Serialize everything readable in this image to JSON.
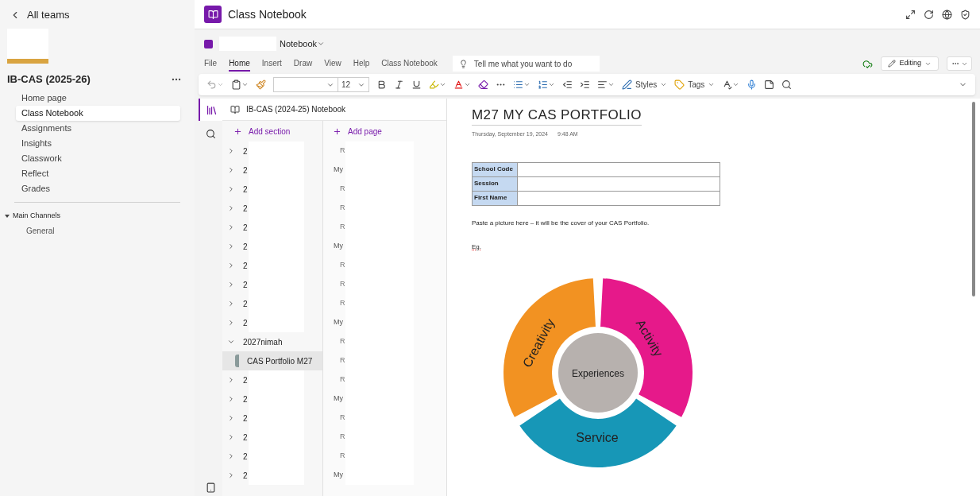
{
  "sidebar": {
    "back_link": "All teams",
    "team_name": "IB-CAS (2025-26)",
    "menu_items": [
      {
        "label": "Home page",
        "selected": false
      },
      {
        "label": "Class Notebook",
        "selected": true
      },
      {
        "label": "Assignments",
        "selected": false
      },
      {
        "label": "Insights",
        "selected": false
      },
      {
        "label": "Classwork",
        "selected": false
      },
      {
        "label": "Reflect",
        "selected": false
      },
      {
        "label": "Grades",
        "selected": false
      }
    ],
    "channel_group": {
      "label": "Main Channels",
      "expanded": true,
      "children": [
        {
          "label": "General"
        }
      ]
    }
  },
  "header": {
    "title": "Class Notebook"
  },
  "notebook": {
    "name": "Notebook",
    "menu_tabs": [
      {
        "label": "File",
        "selected": false
      },
      {
        "label": "Home",
        "selected": true
      },
      {
        "label": "Insert",
        "selected": false
      },
      {
        "label": "Draw",
        "selected": false
      },
      {
        "label": "View",
        "selected": false
      },
      {
        "label": "Help",
        "selected": false
      },
      {
        "label": "Class Notebook",
        "selected": false
      }
    ],
    "tell_me": {
      "placeholder": "Tell me what you want to do"
    },
    "mode_button": "Editing",
    "font_size": "12",
    "styles_button": "Styles",
    "tags_button": "Tags"
  },
  "navigation": {
    "notebook_title": "IB-CAS (2024-25) Notebook",
    "add_section": "Add section",
    "add_page": "Add page",
    "sections": [
      {
        "label": "2",
        "expanded": false
      },
      {
        "label": "2",
        "expanded": false
      },
      {
        "label": "2",
        "expanded": false
      },
      {
        "label": "2",
        "expanded": false
      },
      {
        "label": "2",
        "expanded": false
      },
      {
        "label": "2",
        "expanded": false
      },
      {
        "label": "2",
        "expanded": false
      },
      {
        "label": "2",
        "expanded": false
      },
      {
        "label": "2",
        "expanded": false
      },
      {
        "label": "2",
        "expanded": false
      },
      {
        "label": "2027nimah",
        "expanded": true,
        "children": [
          {
            "label": "CAS Portfolio M27",
            "selected": true
          }
        ]
      },
      {
        "label": "2",
        "expanded": false
      },
      {
        "label": "2",
        "expanded": false
      },
      {
        "label": "2",
        "expanded": false
      },
      {
        "label": "2",
        "expanded": false
      },
      {
        "label": "2",
        "expanded": false
      },
      {
        "label": "2",
        "expanded": false
      }
    ],
    "pages": [
      {
        "label": "R",
        "kind": "subpage"
      },
      {
        "label": "My",
        "kind": "page"
      },
      {
        "label": "R",
        "kind": "subpage"
      },
      {
        "label": "R",
        "kind": "subpage"
      },
      {
        "label": "R",
        "kind": "subpage"
      },
      {
        "label": "My",
        "kind": "page"
      },
      {
        "label": "R",
        "kind": "subpage"
      },
      {
        "label": "R",
        "kind": "subpage"
      },
      {
        "label": "R",
        "kind": "subpage"
      },
      {
        "label": "My",
        "kind": "page"
      },
      {
        "label": "R",
        "kind": "subpage"
      },
      {
        "label": "R",
        "kind": "subpage"
      },
      {
        "label": "R",
        "kind": "subpage"
      },
      {
        "label": "My",
        "kind": "page"
      },
      {
        "label": "R",
        "kind": "subpage"
      },
      {
        "label": "R",
        "kind": "subpage"
      },
      {
        "label": "R",
        "kind": "subpage"
      },
      {
        "label": "My",
        "kind": "page"
      }
    ]
  },
  "page": {
    "title": "M27 MY CAS PORTFOLIO",
    "date": "Thursday, September 19, 2024",
    "time": "9:48 AM",
    "table_rows": [
      {
        "label": "School Code"
      },
      {
        "label": "Session"
      },
      {
        "label": "First Name"
      }
    ],
    "paragraph": "Paste a picture here – it will be the cover of your CAS Portfolio.",
    "example": "Eg.",
    "diagram": {
      "center": "Experiences",
      "segments": [
        {
          "label": "Activity",
          "color": "#e6198a"
        },
        {
          "label": "Service",
          "color": "#1797b7"
        },
        {
          "label": "Creativity",
          "color": "#f29222"
        }
      ]
    }
  }
}
